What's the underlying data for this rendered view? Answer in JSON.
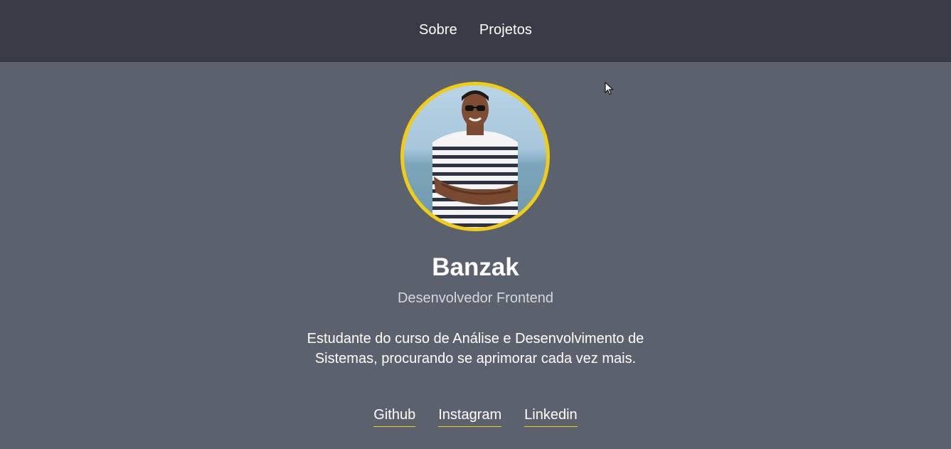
{
  "nav": {
    "items": [
      {
        "label": "Sobre"
      },
      {
        "label": "Projetos"
      }
    ]
  },
  "profile": {
    "name": "Banzak",
    "role": "Desenvolvedor Frontend",
    "bio": "Estudante do curso de Análise e Desenvolvimento de Sistemas, procurando se aprimorar cada vez mais.",
    "avatar_border_color": "#f2cc13"
  },
  "social": {
    "links": [
      {
        "label": "Github"
      },
      {
        "label": "Instagram"
      },
      {
        "label": "Linkedin"
      }
    ]
  },
  "colors": {
    "header_bg": "#393c46",
    "page_bg": "#5b616d",
    "accent": "#f2cc13"
  },
  "icons": {
    "cursor": "mouse-pointer-icon"
  }
}
